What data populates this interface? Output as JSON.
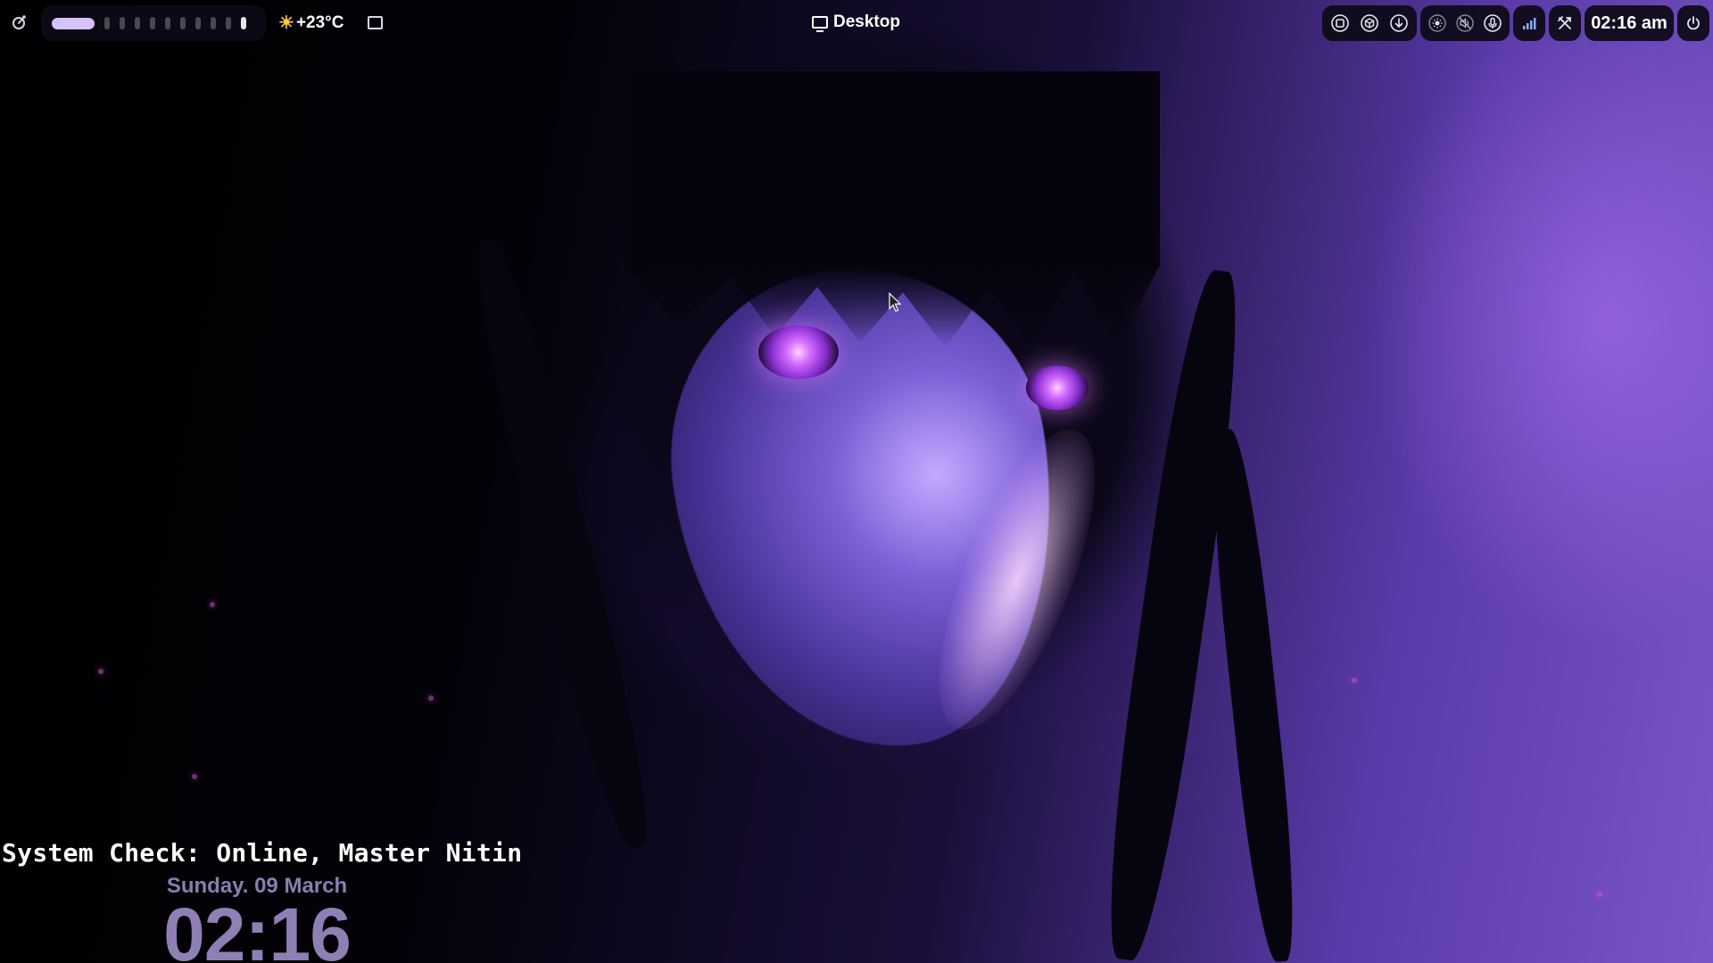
{
  "topbar": {
    "workspaces": {
      "active_index": 0,
      "count": 11
    },
    "weather": {
      "icon": "sun-icon",
      "temperature": "+23°C"
    },
    "window_title": "Desktop",
    "tray": {
      "icons": [
        "screenshot-icon",
        "package-icon",
        "download-icon",
        "brightness-icon",
        "speaker-muted-icon",
        "microphone-icon",
        "signal-icon",
        "tools-icon",
        "power-icon"
      ]
    },
    "clock": "02:16 am"
  },
  "desktop": {
    "greeting": "System Check: Online, Master Nitin",
    "date": "Sunday. 09 March",
    "time": "02:16"
  },
  "colors": {
    "accent": "#d6c2ff",
    "widget_text": "#8e7fb4",
    "bar_bg": "#0c0a16"
  }
}
